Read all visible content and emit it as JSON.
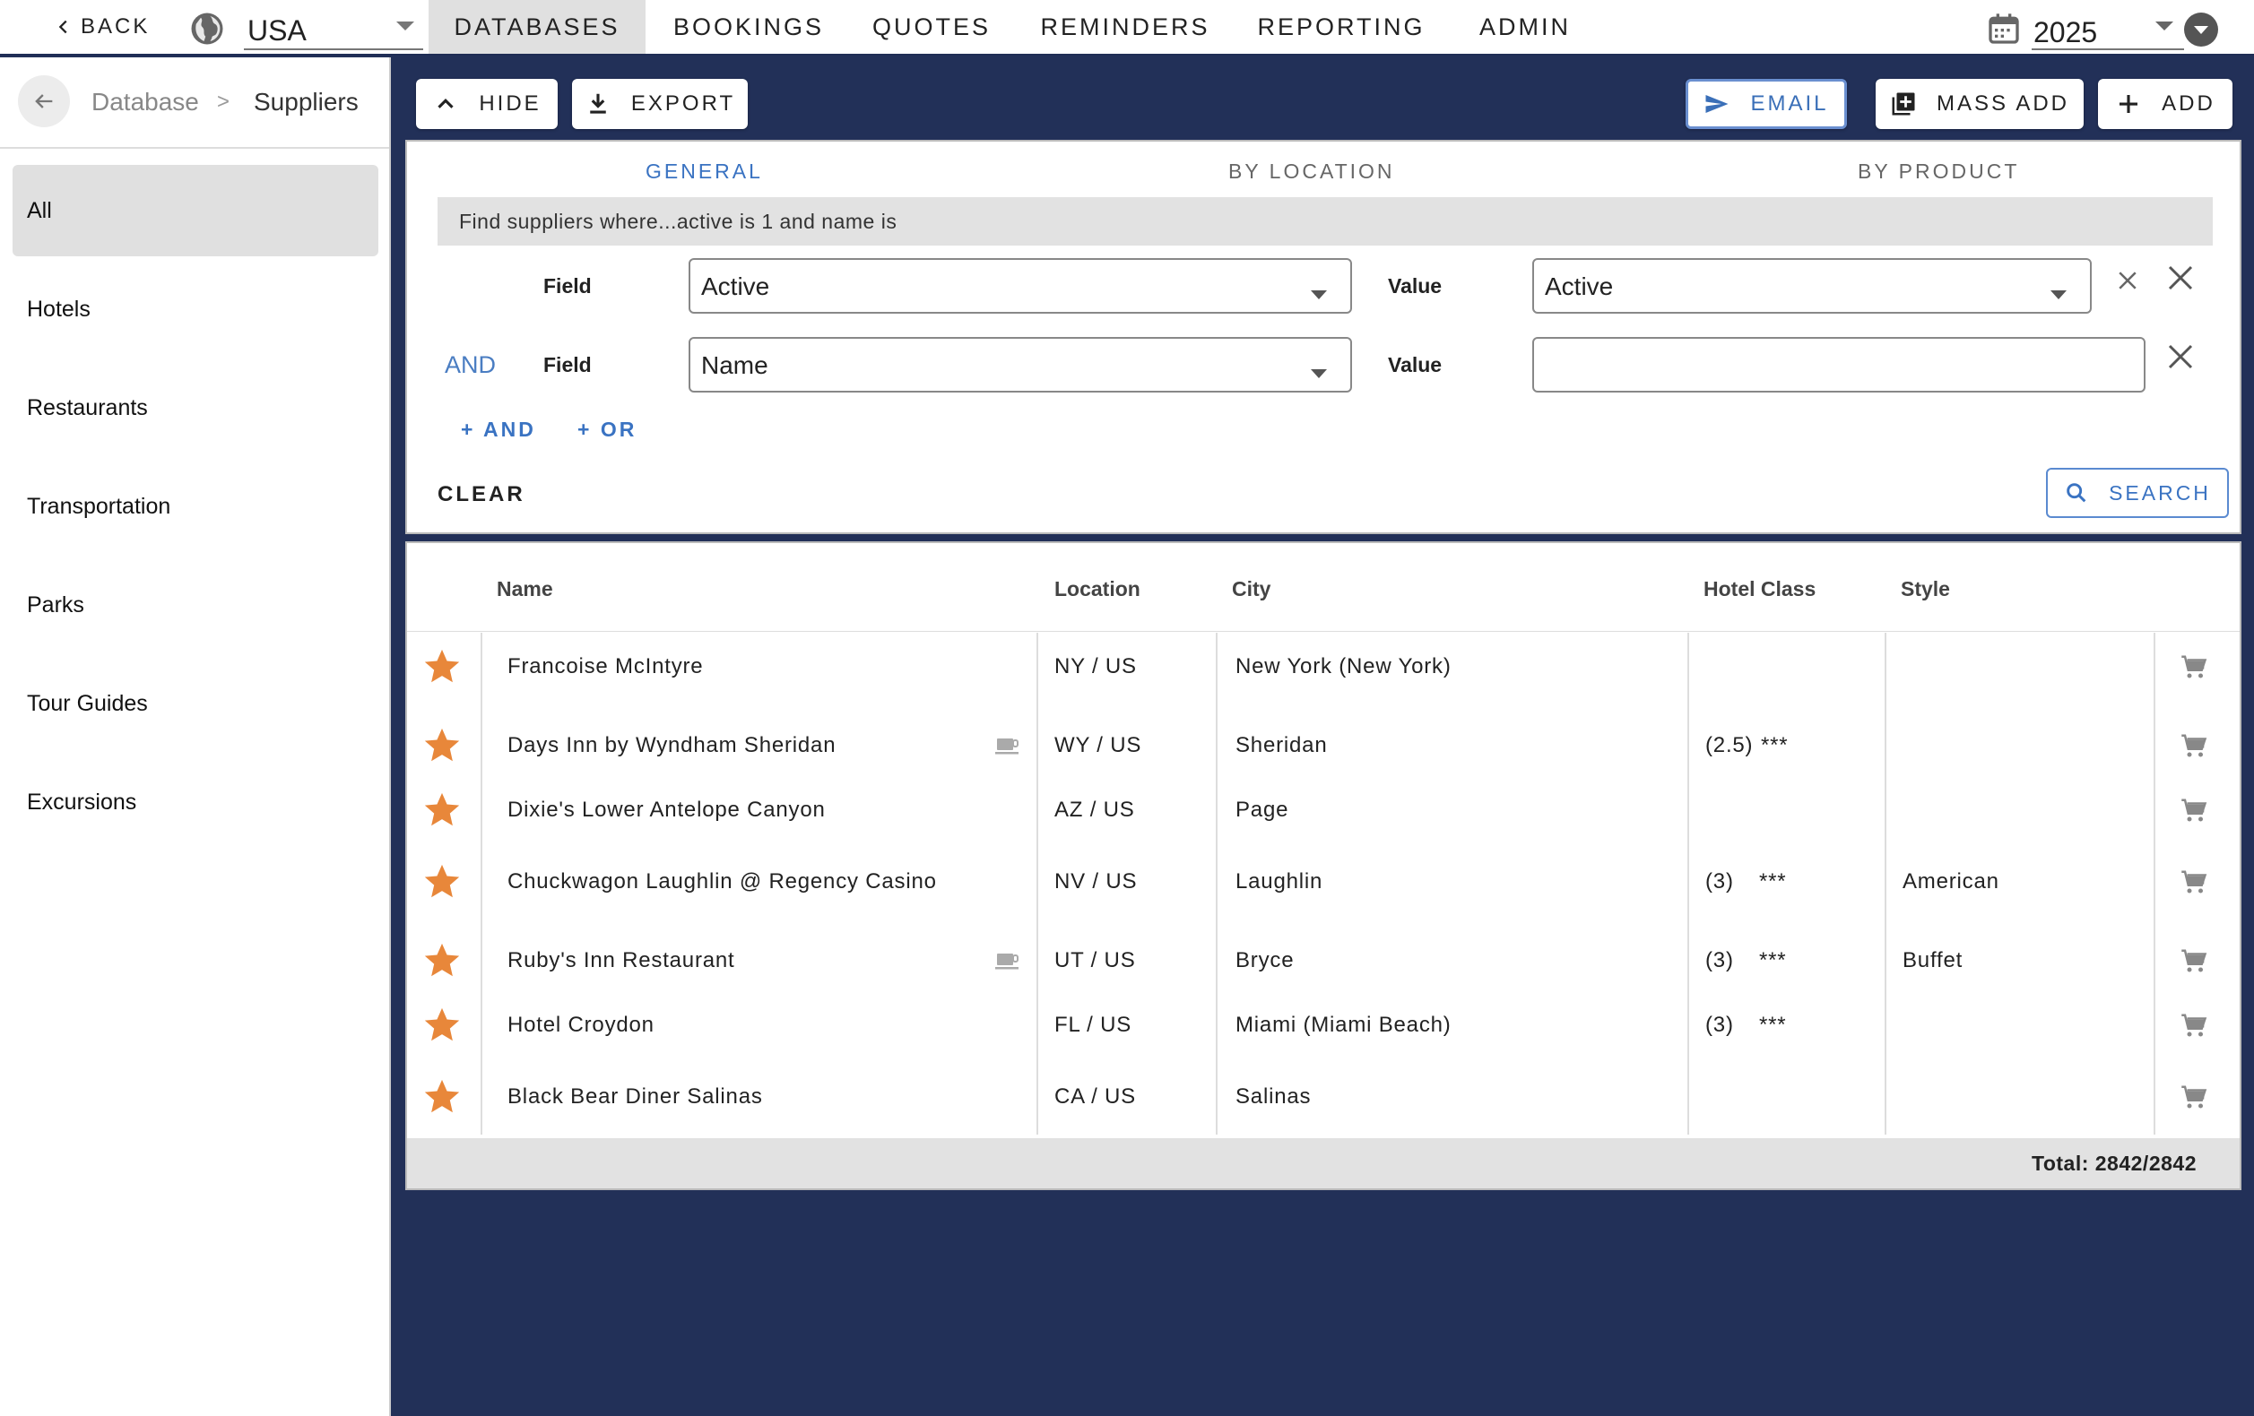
{
  "topbar": {
    "back_label": "BACK",
    "country": "USA",
    "year": "2025",
    "nav": [
      {
        "label": "DATABASES",
        "active": true
      },
      {
        "label": "BOOKINGS",
        "active": false
      },
      {
        "label": "QUOTES",
        "active": false
      },
      {
        "label": "REMINDERS",
        "active": false
      },
      {
        "label": "REPORTING",
        "active": false
      },
      {
        "label": "ADMIN",
        "active": false
      }
    ]
  },
  "sidebar": {
    "breadcrumb": {
      "parent": "Database",
      "separator": ">",
      "current": "Suppliers"
    },
    "items": [
      {
        "label": "All",
        "active": true
      },
      {
        "label": "Hotels",
        "active": false
      },
      {
        "label": "Restaurants",
        "active": false
      },
      {
        "label": "Transportation",
        "active": false
      },
      {
        "label": "Parks",
        "active": false
      },
      {
        "label": "Tour Guides",
        "active": false
      },
      {
        "label": "Excursions",
        "active": false
      }
    ]
  },
  "toolbar": {
    "hide_label": "HIDE",
    "export_label": "EXPORT",
    "email_label": "EMAIL",
    "mass_add_label": "MASS ADD",
    "add_label": "ADD"
  },
  "filter": {
    "tabs": [
      {
        "label": "GENERAL",
        "active": true
      },
      {
        "label": "BY LOCATION",
        "active": false
      },
      {
        "label": "BY PRODUCT",
        "active": false
      }
    ],
    "summary": "Find suppliers where...active is 1 and name is",
    "field_label": "Field",
    "value_label": "Value",
    "and_label": "AND",
    "conditions": [
      {
        "field": "Active",
        "value": "Active"
      },
      {
        "field": "Name",
        "value": ""
      }
    ],
    "add_and_label": "+ AND",
    "add_or_label": "+ OR",
    "clear_label": "CLEAR",
    "search_label": "SEARCH"
  },
  "results": {
    "columns": {
      "name": "Name",
      "location": "Location",
      "city": "City",
      "hotel_class": "Hotel Class",
      "style": "Style"
    },
    "rows": [
      {
        "name": "Francoise McIntyre",
        "location": "NY / US",
        "city": "New York (New York)",
        "hotel_class": "",
        "stars": "",
        "style": "",
        "mug": false,
        "favorite": true
      },
      {
        "name": "Days Inn by Wyndham Sheridan",
        "location": "WY / US",
        "city": "Sheridan",
        "hotel_class": "(2.5)",
        "stars": "***",
        "style": "",
        "mug": true,
        "favorite": true
      },
      {
        "name": "Dixie's Lower Antelope Canyon",
        "location": "AZ / US",
        "city": "Page",
        "hotel_class": "",
        "stars": "",
        "style": "",
        "mug": false,
        "favorite": true
      },
      {
        "name": "Chuckwagon Laughlin @ Regency Casino",
        "location": "NV / US",
        "city": "Laughlin",
        "hotel_class": "(3)",
        "stars": "***",
        "style": "American",
        "mug": false,
        "favorite": true
      },
      {
        "name": "Ruby's Inn Restaurant",
        "location": "UT / US",
        "city": "Bryce",
        "hotel_class": "(3)",
        "stars": "***",
        "style": "Buffet",
        "mug": true,
        "favorite": true
      },
      {
        "name": "Hotel Croydon",
        "location": "FL / US",
        "city": "Miami (Miami Beach)",
        "hotel_class": "(3)",
        "stars": "***",
        "style": "",
        "mug": false,
        "favorite": true
      },
      {
        "name": "Black Bear Diner Salinas",
        "location": "CA / US",
        "city": "Salinas",
        "hotel_class": "",
        "stars": "",
        "style": "",
        "mug": false,
        "favorite": true
      }
    ],
    "total": "Total: 2842/2842"
  },
  "colors": {
    "accent": "#3a73c2",
    "star": "#e8873a",
    "background": "#223058"
  }
}
